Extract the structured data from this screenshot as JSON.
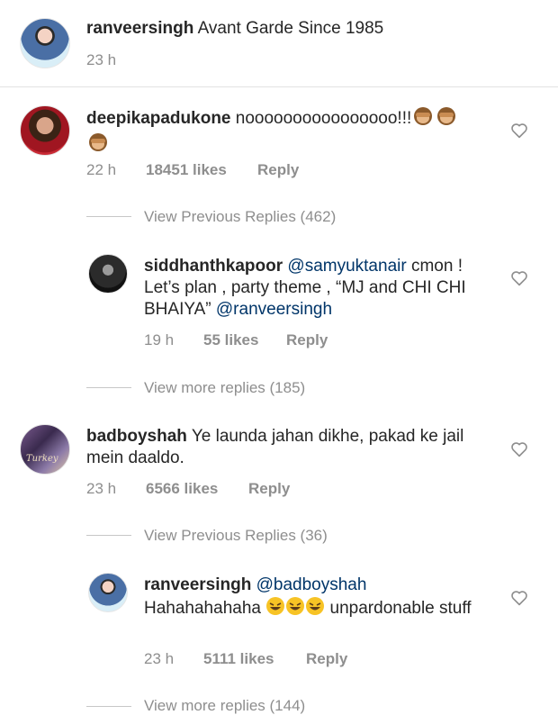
{
  "caption": {
    "username": "ranveersingh",
    "text": "Avant Garde Since 1985",
    "time": "23 h"
  },
  "comments": [
    {
      "username": "deepikapadukone",
      "text": "noooooooooooooooo!!!",
      "emoji_desc": "see-no-evil-monkey",
      "time": "22 h",
      "likes": "18451 likes",
      "reply": "Reply",
      "view_replies": "View Previous Replies (462)"
    },
    {
      "username": "siddhanthkapoor",
      "mention1": "@samyuktanair",
      "text1": " cmon ! Let’s plan , party theme , “MJ and CHI CHI BHAIYA” ",
      "mention2": "@ranveersingh",
      "time": "19 h",
      "likes": "55 likes",
      "reply": "Reply",
      "view_replies": "View more replies (185)"
    },
    {
      "username": "badboyshah",
      "text": "Ye launda jahan dikhe, pakad ke jail mein daaldo.",
      "avatar_text": "Turkey",
      "time": "23 h",
      "likes": "6566 likes",
      "reply": "Reply",
      "view_replies": "View Previous Replies (36)"
    },
    {
      "username": "ranveersingh",
      "mention": "@badboyshah",
      "text_a": "Hahahahahaha",
      "text_b": "unpardonable stuff",
      "emoji_desc": "rolling-on-floor-laughing",
      "time": "23 h",
      "likes": "5111 likes",
      "reply": "Reply",
      "view_replies": "View more replies (144)"
    }
  ],
  "icons": {
    "like": "heart-icon",
    "monkey": "see-no-evil-monkey-emoji",
    "laugh": "rolling-laughing-emoji"
  }
}
